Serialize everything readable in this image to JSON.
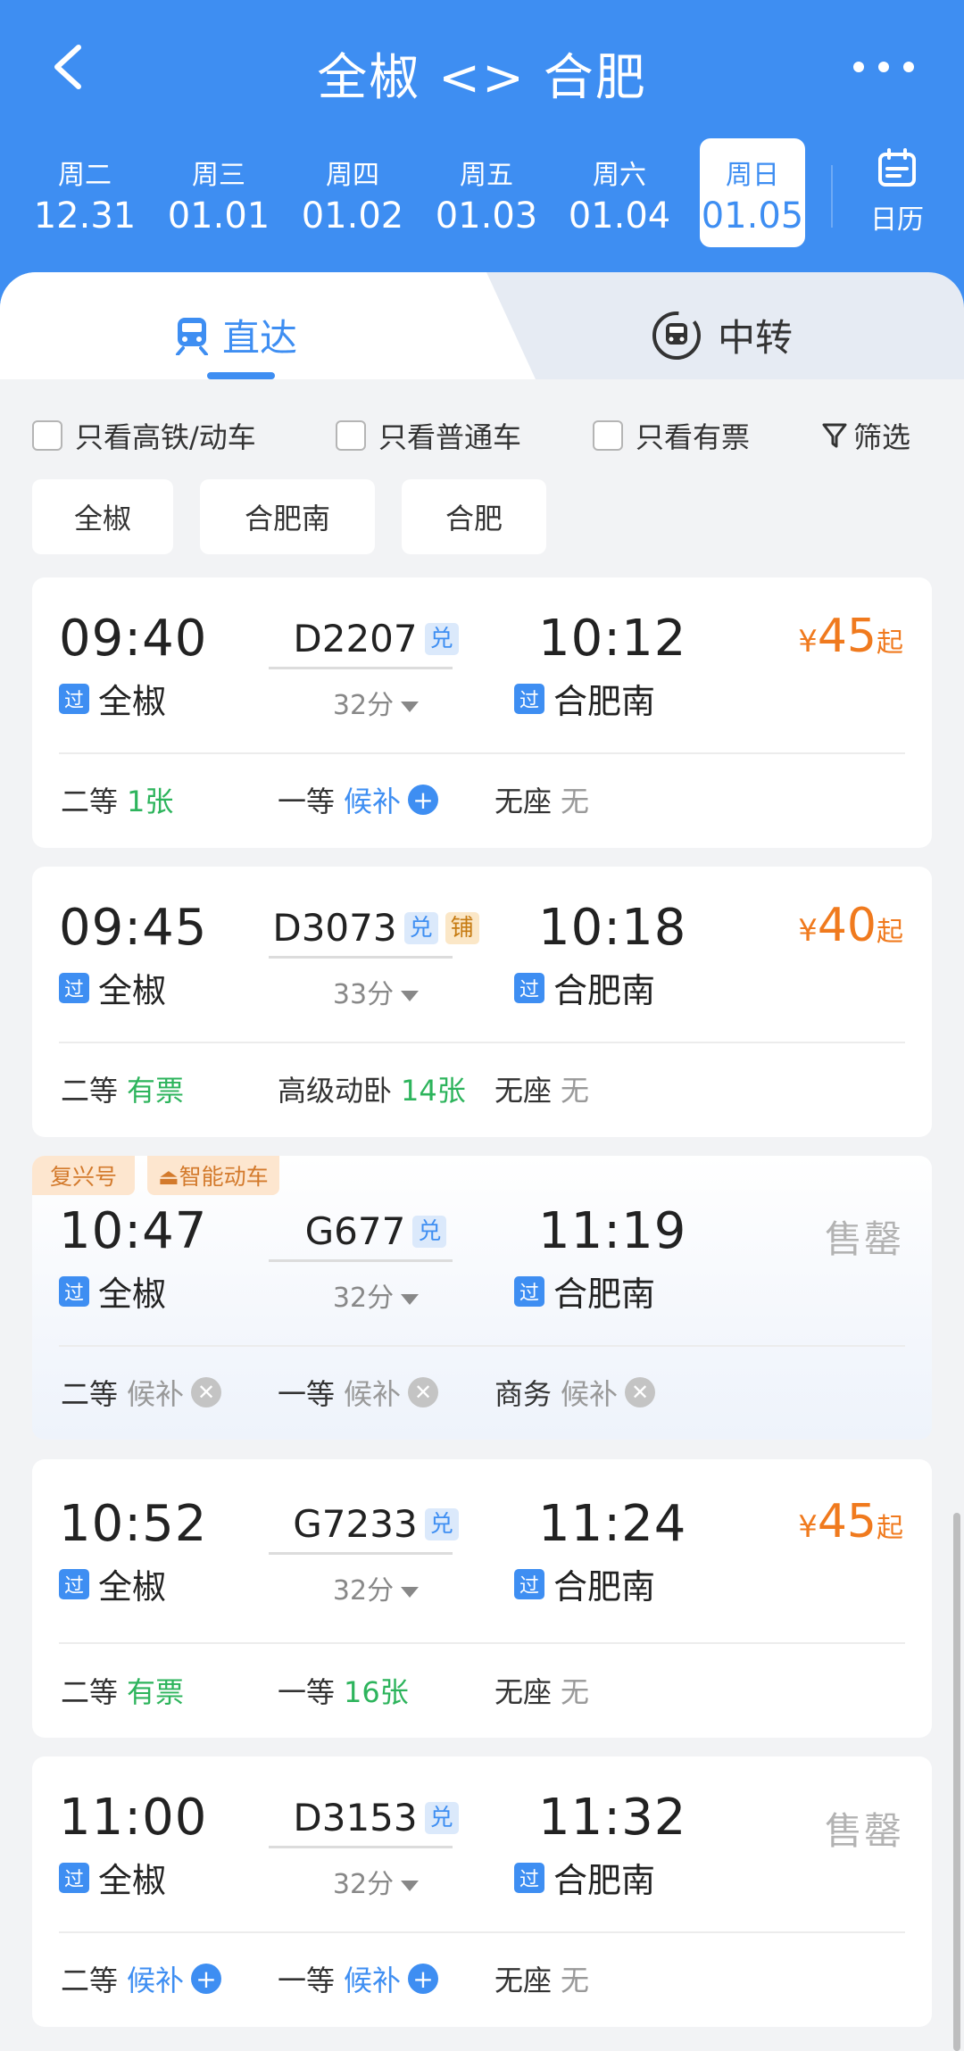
{
  "header": {
    "title": "全椒 <> 合肥",
    "back_icon": "chevron-left-icon",
    "more_icon": "more-dots-icon"
  },
  "dates": [
    {
      "weekday": "周二",
      "date": "12.31"
    },
    {
      "weekday": "周三",
      "date": "01.01"
    },
    {
      "weekday": "周四",
      "date": "01.02"
    },
    {
      "weekday": "周五",
      "date": "01.03"
    },
    {
      "weekday": "周六",
      "date": "01.04"
    },
    {
      "weekday": "周日",
      "date": "01.05",
      "active": true
    }
  ],
  "calendar_label": "日历",
  "tabs": {
    "direct": "直达",
    "transfer": "中转"
  },
  "filters": {
    "highspeed": "只看高铁/动车",
    "normal": "只看普通车",
    "available": "只看有票",
    "filter": "筛选"
  },
  "stations": [
    "全椒",
    "合肥南",
    "合肥"
  ],
  "trains": [
    {
      "dep": "09:40",
      "arr": "10:12",
      "no": "D2207",
      "badges": [
        "兑"
      ],
      "duration": "32分",
      "from": "全椒",
      "to": "合肥南",
      "pass": "过",
      "price_symbol": "¥",
      "price": "45",
      "price_suffix": "起",
      "seats": [
        {
          "name": "二等",
          "value": "1张"
        },
        {
          "name": "一等",
          "value": "候补"
        },
        {
          "name": "无座",
          "value": "无"
        }
      ]
    },
    {
      "dep": "09:45",
      "arr": "10:18",
      "no": "D3073",
      "badges": [
        "兑",
        "铺"
      ],
      "duration": "33分",
      "from": "全椒",
      "to": "合肥南",
      "pass": "过",
      "price_symbol": "¥",
      "price": "40",
      "price_suffix": "起",
      "seats": [
        {
          "name": "二等",
          "value": "有票"
        },
        {
          "name": "高级动卧",
          "value": "14张"
        },
        {
          "name": "无座",
          "value": "无"
        }
      ]
    },
    {
      "tags": [
        "复兴号",
        "智能动车"
      ],
      "dep": "10:47",
      "arr": "11:19",
      "no": "G677",
      "badges": [
        "兑"
      ],
      "duration": "32分",
      "from": "全椒",
      "to": "合肥南",
      "pass": "过",
      "status": "售罄",
      "seats": [
        {
          "name": "二等",
          "value": "候补"
        },
        {
          "name": "一等",
          "value": "候补"
        },
        {
          "name": "商务",
          "value": "候补"
        }
      ]
    },
    {
      "dep": "10:52",
      "arr": "11:24",
      "no": "G7233",
      "badges": [
        "兑"
      ],
      "duration": "32分",
      "from": "全椒",
      "to": "合肥南",
      "pass": "过",
      "price_symbol": "¥",
      "price": "45",
      "price_suffix": "起",
      "seats": [
        {
          "name": "二等",
          "value": "有票"
        },
        {
          "name": "一等",
          "value": "16张"
        },
        {
          "name": "无座",
          "value": "无"
        }
      ]
    },
    {
      "dep": "11:00",
      "arr": "11:32",
      "no": "D3153",
      "badges": [
        "兑"
      ],
      "duration": "32分",
      "from": "全椒",
      "to": "合肥南",
      "pass": "过",
      "status": "售罄",
      "seats": [
        {
          "name": "二等",
          "value": "候补"
        },
        {
          "name": "一等",
          "value": "候补"
        },
        {
          "name": "无座",
          "value": "无"
        }
      ]
    }
  ],
  "colors": {
    "primary": "#3e8ef2",
    "price": "#f07a1e",
    "available": "#2db45c",
    "muted": "#999999"
  }
}
